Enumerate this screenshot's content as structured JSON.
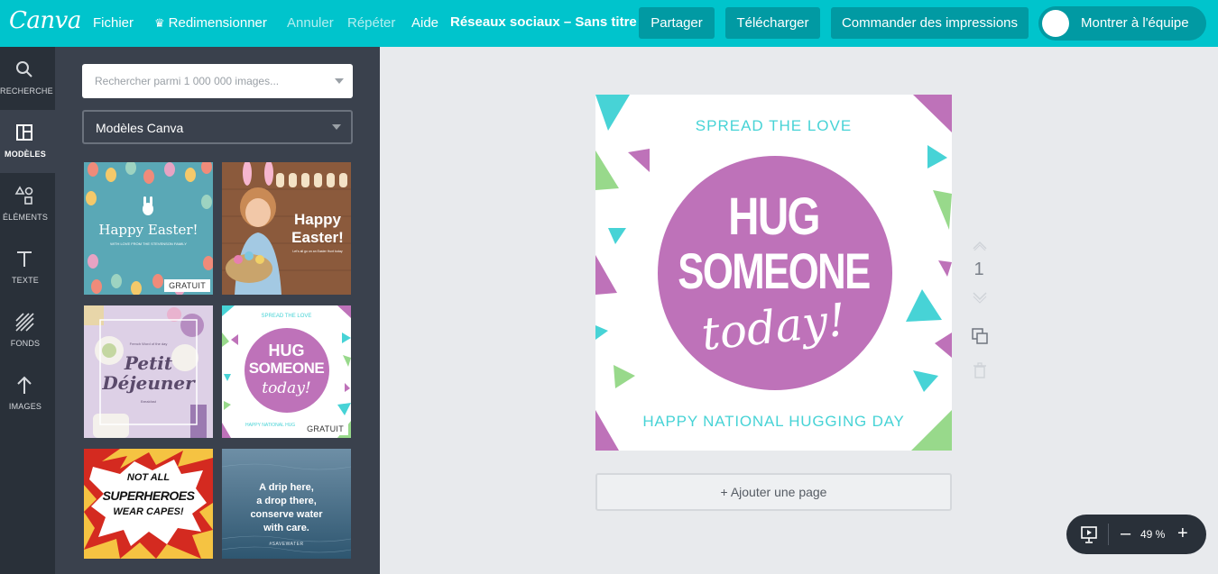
{
  "topbar": {
    "logo": "Canva",
    "file": "Fichier",
    "resize": "Redimensionner",
    "undo": "Annuler",
    "redo": "Répéter",
    "help": "Aide",
    "doc_title": "Réseaux sociaux – Sans titre",
    "share": "Partager",
    "download": "Télécharger",
    "order_prints": "Commander des impressions",
    "show_team": "Montrer à l'équipe"
  },
  "leftnav": {
    "items": [
      {
        "label": "RECHERCHE",
        "icon": "search-icon"
      },
      {
        "label": "MODÈLES",
        "icon": "layout-icon"
      },
      {
        "label": "ÉLÉMENTS",
        "icon": "shapes-icon"
      },
      {
        "label": "TEXTE",
        "icon": "text-icon"
      },
      {
        "label": "FONDS",
        "icon": "hatch-icon"
      },
      {
        "label": "IMAGES",
        "icon": "upload-arrow-icon"
      }
    ]
  },
  "panel": {
    "search_placeholder": "Rechercher parmi 1 000 000 images...",
    "category": "Modèles Canva",
    "templates": [
      {
        "name": "easter-eggs",
        "line1": "Happy Easter!",
        "line2": "WITH LOVE FROM THE STEVENSON FAMILY",
        "badge": "GRATUIT"
      },
      {
        "name": "easter-girl",
        "line1": "Happy",
        "line2": "Easter!",
        "line3": "Let's all go on an Easter Hunt today"
      },
      {
        "name": "petit-dejeuner",
        "line1": "Petit",
        "line2": "Déjeuner",
        "line3": "French Word of the day",
        "line4": "Breakfast"
      },
      {
        "name": "hug-someone",
        "line1": "SPREAD THE LOVE",
        "line2": "HUG",
        "line3": "SOMEONE",
        "line4": "today!",
        "line5": "HAPPY NATIONAL HUG",
        "badge": "GRATUIT"
      },
      {
        "name": "superheroes",
        "line1": "NOT ALL",
        "line2": "SUPERHEROES",
        "line3": "WEAR CAPES!"
      },
      {
        "name": "save-water",
        "line1": "A drip here,",
        "line2": "a drop there,",
        "line3": "conserve water",
        "line4": "with care.",
        "line5": "#SAVEWATER"
      }
    ]
  },
  "design": {
    "top_text": "SPREAD THE LOVE",
    "word1": "HUG",
    "word2": "SOMEONE",
    "word3": "today!",
    "bottom_text": "HAPPY NATIONAL HUGGING DAY",
    "colors": {
      "teal": "#47d3d6",
      "purple": "#be72b9",
      "green": "#98d98b"
    }
  },
  "page": {
    "number": "1",
    "add_page": "+ Ajouter une page"
  },
  "zoom": {
    "value": "49 %",
    "minus": "–",
    "plus": "+"
  }
}
